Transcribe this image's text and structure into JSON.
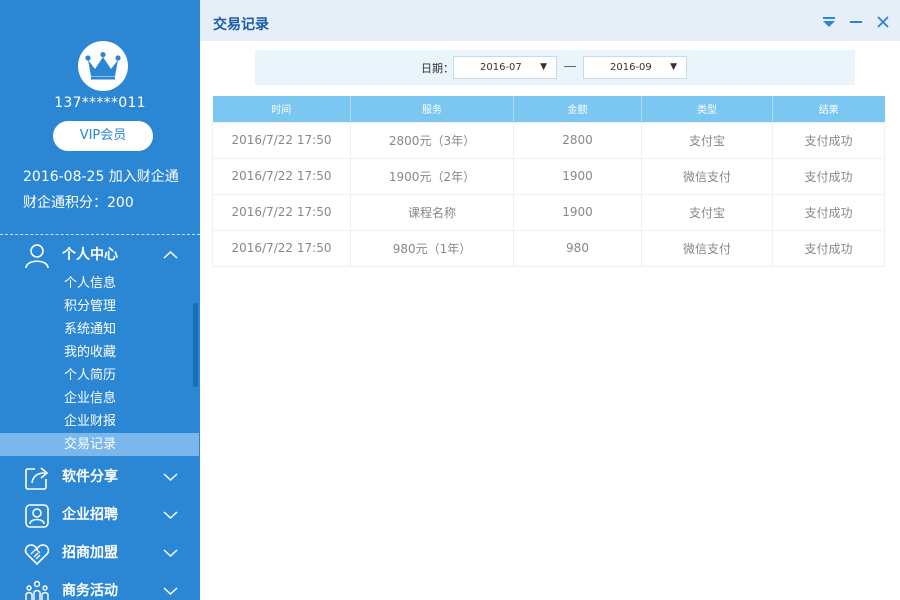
{
  "user": {
    "phone": "137*****011",
    "vip_label": "VIP会员",
    "join_text": "2016-08-25 加入财企通",
    "points_text": "财企通积分：200"
  },
  "nav": {
    "personal_center": "个人中心",
    "sub_items": [
      "个人信息",
      "积分管理",
      "系统通知",
      "我的收藏",
      "个人简历",
      "企业信息",
      "企业财报",
      "交易记录"
    ],
    "active_sub_item": "交易记录",
    "software_share": "软件分享",
    "recruitment": "企业招聘",
    "franchise": "招商加盟",
    "business_activity": "商务活动"
  },
  "page": {
    "title": "交易记录"
  },
  "filter": {
    "label": "日期：",
    "start": "2016-07",
    "end": "2016-09",
    "arrow": "▼"
  },
  "table": {
    "headers": [
      "时间",
      "服务",
      "金额",
      "类型",
      "结果"
    ],
    "rows": [
      [
        "2016/7/22 17:50",
        "2800元（3年）",
        "2800",
        "支付宝",
        "支付成功"
      ],
      [
        "2016/7/22 17:50",
        "1900元（2年）",
        "1900",
        "微信支付",
        "支付成功"
      ],
      [
        "2016/7/22 17:50",
        "课程名称",
        "1900",
        "支付宝",
        "支付成功"
      ],
      [
        "2016/7/22 17:50",
        "980元（1年）",
        "980",
        "微信支付",
        "支付成功"
      ]
    ]
  },
  "icons": {
    "avatar": "crown-icon",
    "personal": "user-icon",
    "software": "share-icon",
    "recruitment": "recruit-icon",
    "franchise": "handshake-icon",
    "business": "people-group-icon"
  },
  "colors": {
    "sidebar": "#2b86d4",
    "active_item": "#7bb7ea",
    "table_header": "#7bc7f2",
    "title": "#1a5aa8"
  }
}
